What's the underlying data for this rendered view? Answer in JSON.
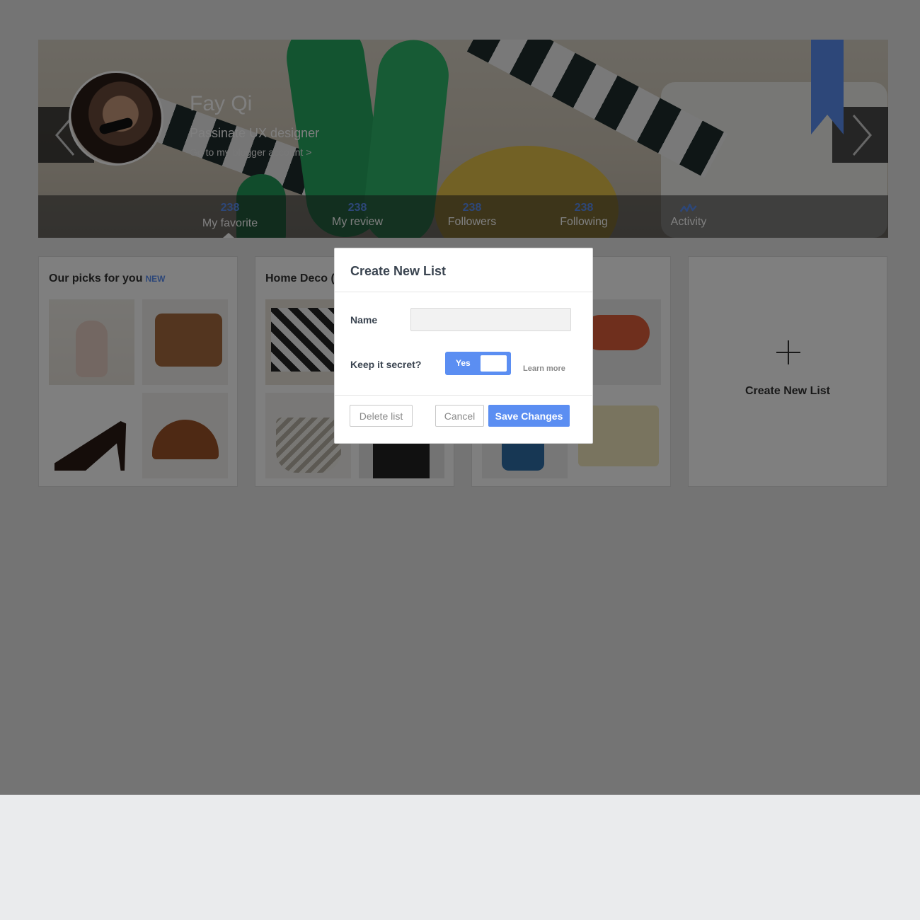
{
  "profile": {
    "name": "Fay Qi",
    "tagline": "Passinate UX designer",
    "blogger_link": "Go to my blogger account >"
  },
  "stats": [
    {
      "count": "238",
      "label": "My favorite",
      "active": true
    },
    {
      "count": "238",
      "label": "My review"
    },
    {
      "count": "238",
      "label": "Followers"
    },
    {
      "count": "238",
      "label": "Following"
    },
    {
      "count": "",
      "label": "Activity",
      "icon": "activity-icon"
    }
  ],
  "cards": [
    {
      "title": "Our picks for you",
      "badge": "NEW"
    },
    {
      "title": "Home Deco ("
    },
    {
      "title": ""
    }
  ],
  "create_card": {
    "label": "Create New List",
    "icon": "plus-icon"
  },
  "modal": {
    "title": "Create New List",
    "name_label": "Name",
    "name_value": "",
    "secret_label": "Keep it secret?",
    "toggle_label": "Yes",
    "toggle_on": true,
    "learn_more": "Learn more",
    "delete_label": "Delete list",
    "cancel_label": "Cancel",
    "save_label": "Save Changes"
  },
  "colors": {
    "accent": "#5b8ef2",
    "overlay": "rgba(0,0,0,0.5)",
    "page_bg": "#eaebed"
  },
  "icons": [
    "chevron-left-icon",
    "chevron-right-icon",
    "bookmark-icon",
    "activity-icon",
    "plus-icon"
  ]
}
